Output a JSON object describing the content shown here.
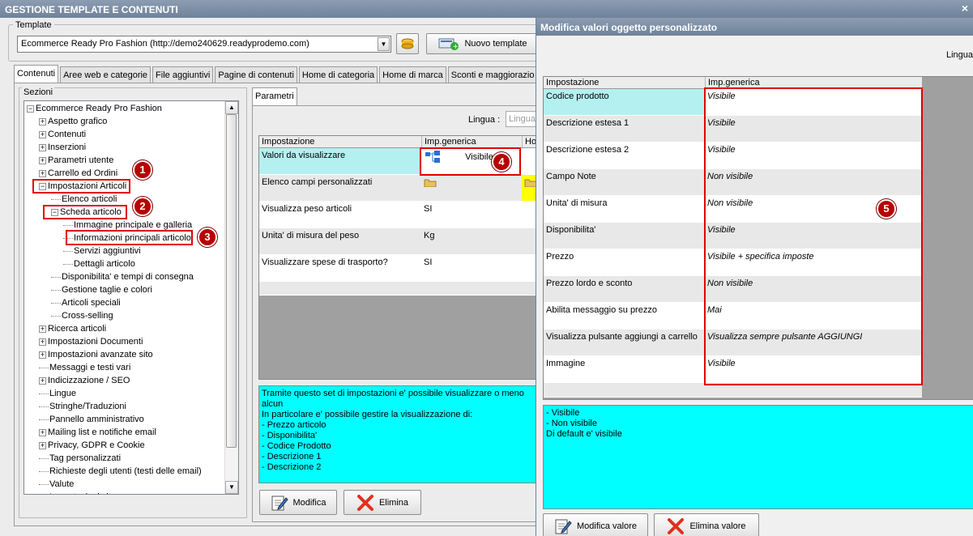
{
  "window": {
    "title": "GESTIONE TEMPLATE E CONTENUTI",
    "close_glyph": "×"
  },
  "template": {
    "group_label": "Template",
    "selected": "Ecommerce Ready Pro Fashion (http://demo240629.readyprodemo.com)",
    "new_button": "Nuovo template"
  },
  "tabs": [
    "Contenuti",
    "Aree web e categorie",
    "File aggiuntivi",
    "Pagine di contenuti",
    "Home di categoria",
    "Home di marca",
    "Sconti e maggiorazio"
  ],
  "sections": {
    "label": "Sezioni",
    "tree": [
      {
        "label": "Ecommerce Ready Pro Fashion",
        "exp": "−"
      },
      {
        "label": "Aspetto grafico",
        "exp": "+"
      },
      {
        "label": "Contenuti",
        "exp": "+"
      },
      {
        "label": "Inserzioni",
        "exp": "+"
      },
      {
        "label": "Parametri utente",
        "exp": "+"
      },
      {
        "label": "Carrello ed Ordini",
        "exp": "+"
      },
      {
        "label": "Impostazioni Articoli",
        "exp": "−"
      },
      {
        "label": "Elenco articoli",
        "exp": ""
      },
      {
        "label": "Scheda articolo",
        "exp": "−"
      },
      {
        "label": "Immagine principale e galleria",
        "exp": ""
      },
      {
        "label": "Informazioni principali articolo",
        "exp": ""
      },
      {
        "label": "Servizi aggiuntivi",
        "exp": ""
      },
      {
        "label": "Dettagli articolo",
        "exp": ""
      },
      {
        "label": "Disponibilita' e tempi di consegna",
        "exp": ""
      },
      {
        "label": "Gestione taglie e colori",
        "exp": ""
      },
      {
        "label": "Articoli speciali",
        "exp": ""
      },
      {
        "label": "Cross-selling",
        "exp": ""
      },
      {
        "label": "Ricerca articoli",
        "exp": "+"
      },
      {
        "label": "Impostazioni Documenti",
        "exp": "+"
      },
      {
        "label": "Impostazioni avanzate sito",
        "exp": "+"
      },
      {
        "label": "Messaggi e testi vari",
        "exp": ""
      },
      {
        "label": "Indicizzazione / SEO",
        "exp": "+"
      },
      {
        "label": "Lingue",
        "exp": ""
      },
      {
        "label": "Stringhe/Traduzioni",
        "exp": ""
      },
      {
        "label": "Pannello amministrativo",
        "exp": ""
      },
      {
        "label": "Mailing list e notifiche email",
        "exp": "+"
      },
      {
        "label": "Privacy, GDPR e Cookie",
        "exp": "+"
      },
      {
        "label": "Tag personalizzati",
        "exp": ""
      },
      {
        "label": "Richieste degli utenti (testi delle email)",
        "exp": ""
      },
      {
        "label": "Valute",
        "exp": ""
      },
      {
        "label": "Impostazioni sito e...",
        "exp": ""
      }
    ]
  },
  "badges": [
    "1",
    "2",
    "3",
    "4",
    "5"
  ],
  "params": {
    "tab": "Parametri",
    "lingua_label": "Lingua :",
    "lingua_value": "Lingua",
    "col_setting": "Impostazione",
    "col_generic": "Imp.generica",
    "col_third": "Ho",
    "rows": [
      {
        "setting": "Valori da visualizzare",
        "value": "Visibile"
      },
      {
        "setting": "Elenco campi personalizzati",
        "value": ""
      },
      {
        "setting": "Visualizza peso articoli",
        "value": "SI"
      },
      {
        "setting": "Unita' di misura del peso",
        "value": "Kg"
      },
      {
        "setting": "Visualizzare spese di trasporto?",
        "value": "SI"
      }
    ],
    "description": [
      "Tramite questo set di impostazioni e' possibile visualizzare o meno alcun",
      "In particolare e' possibile gestire la visualizzazione di:",
      "- Prezzo articolo",
      "- Disponibilita'",
      "- Codice Prodotto",
      "- Descrizione 1",
      "- Descrizione 2"
    ],
    "modifica": "Modifica",
    "elimina": "Elimina"
  },
  "dialog": {
    "title": "Modifica valori oggetto personalizzato",
    "lingua": "Lingua",
    "col_setting": "Impostazione",
    "col_generic": "Imp.generica",
    "rows": [
      {
        "setting": "Codice prodotto",
        "value": "Visibile"
      },
      {
        "setting": "Descrizione estesa 1",
        "value": "Visibile"
      },
      {
        "setting": "Descrizione estesa 2",
        "value": "Visibile"
      },
      {
        "setting": "Campo Note",
        "value": "Non visibile"
      },
      {
        "setting": "Unita' di misura",
        "value": "Non visibile"
      },
      {
        "setting": "Disponibilita'",
        "value": "Visibile"
      },
      {
        "setting": "Prezzo",
        "value": "Visibile + specifica imposte"
      },
      {
        "setting": "Prezzo lordo e sconto",
        "value": "Non visibile"
      },
      {
        "setting": "Abilita messaggio su prezzo",
        "value": "Mai"
      },
      {
        "setting": "Visualizza pulsante aggiungi a carrello",
        "value": "Visualizza sempre pulsante AGGIUNGI"
      },
      {
        "setting": "Immagine",
        "value": "Visibile"
      }
    ],
    "description": [
      "- Visibile",
      "- Non visibile",
      "Di default e' visibile"
    ],
    "modifica_valore": "Modifica valore",
    "elimina_valore": "Elimina valore"
  },
  "colors": {
    "selected_row": "#b4f0f0",
    "description_bg": "#00ffff",
    "highlight": "#e00000",
    "badge": "#b80000"
  }
}
